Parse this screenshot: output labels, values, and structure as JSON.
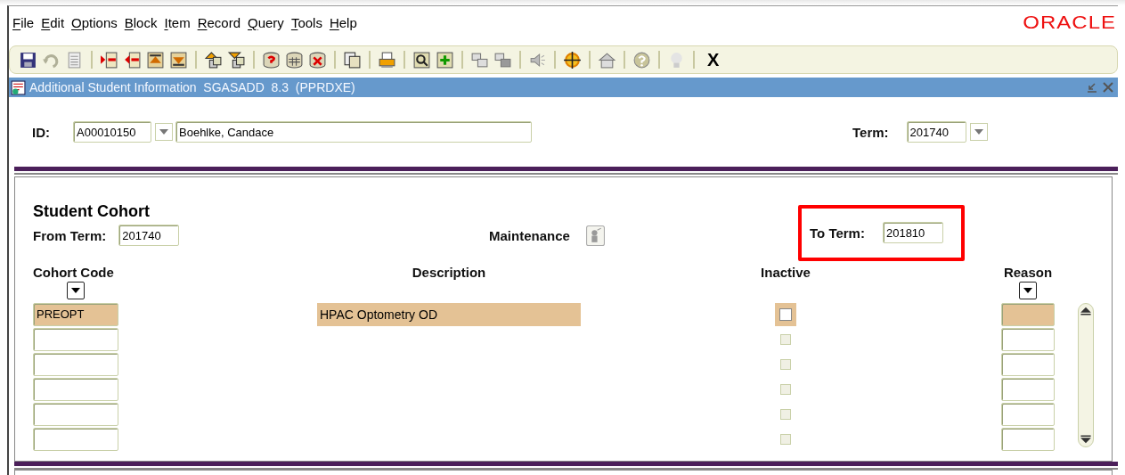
{
  "menu": [
    "File",
    "Edit",
    "Options",
    "Block",
    "Item",
    "Record",
    "Query",
    "Tools",
    "Help"
  ],
  "logo": "ORACLE",
  "toolbar": {
    "exit_label": "X"
  },
  "window": {
    "title": "Additional Student Information  SGASADD  8.3  (PPRDXE)"
  },
  "key_block": {
    "id_label": "ID:",
    "id_value": "A00010150",
    "name_value": "Boehlke, Candace",
    "term_label": "Term:",
    "term_value": "201740"
  },
  "cohort": {
    "title": "Student Cohort",
    "from_term_label": "From Term:",
    "from_term_value": "201740",
    "maintenance_label": "Maintenance",
    "to_term": {
      "label": "To Term:",
      "value": "201810",
      "highlighted": true
    },
    "columns": [
      "Cohort Code",
      "Description",
      "Inactive",
      "Reason"
    ],
    "rows": [
      {
        "selected": true,
        "cohort_code": "PREOPT",
        "description": "HPAC Optometry OD",
        "inactive": false
      },
      {
        "selected": false,
        "inactive": false
      },
      {
        "selected": false,
        "inactive": false
      },
      {
        "selected": false,
        "inactive": false
      },
      {
        "selected": false,
        "inactive": false
      },
      {
        "selected": false,
        "inactive": false
      }
    ]
  }
}
